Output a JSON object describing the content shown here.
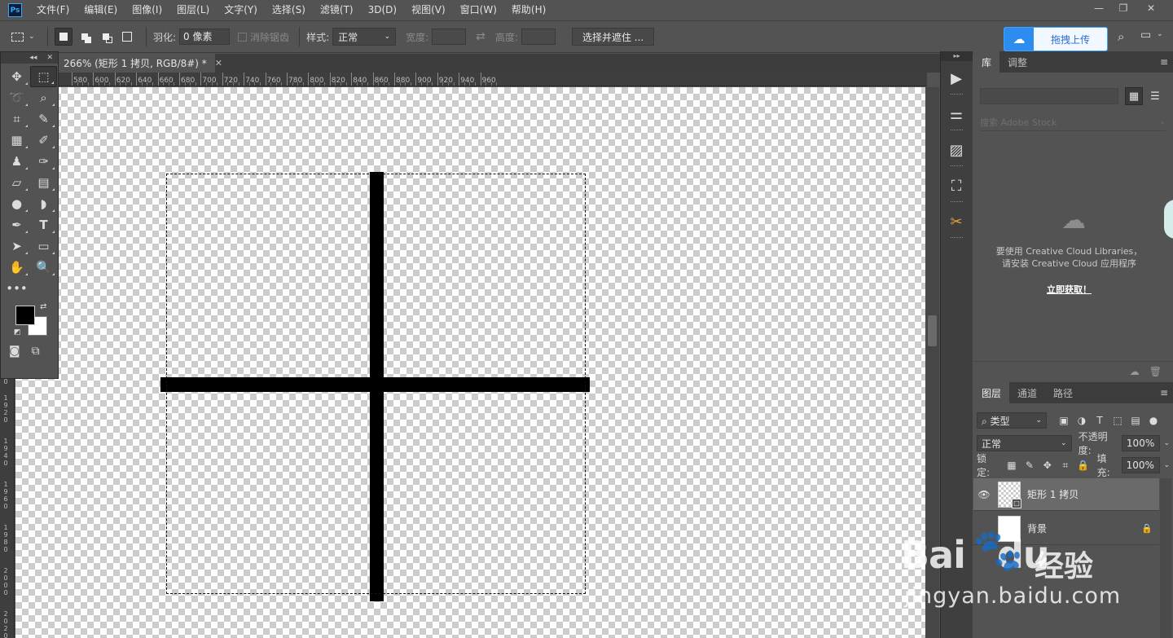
{
  "app": {
    "logo": "Ps"
  },
  "menu": [
    "文件(F)",
    "编辑(E)",
    "图像(I)",
    "图层(L)",
    "文字(Y)",
    "选择(S)",
    "滤镜(T)",
    "3D(D)",
    "视图(V)",
    "窗口(W)",
    "帮助(H)"
  ],
  "window_controls": {
    "minimize": "—",
    "restore": "❐",
    "close": "✕"
  },
  "options": {
    "feather_label": "羽化:",
    "feather_value": "0 像素",
    "antialias_label": "消除锯齿",
    "style_label": "样式:",
    "style_value": "正常",
    "width_label": "宽度:",
    "height_label": "高度:",
    "select_mask_button": "选择并遮住 ...",
    "upload_button": "拖拽上传"
  },
  "document": {
    "tab_title": "266% (矩形 1 拷贝, RGB/8#) *",
    "tab_close": "✕"
  },
  "ruler": {
    "top_ticks": [
      "580",
      "600",
      "620",
      "640",
      "660",
      "680",
      "700",
      "720",
      "740",
      "760",
      "780",
      "800",
      "820",
      "840",
      "860",
      "880",
      "900",
      "920",
      "940",
      "960"
    ],
    "left_ticks": [
      "0",
      "1920",
      "1940",
      "1960",
      "1980",
      "2000",
      "2020"
    ]
  },
  "toolbox": {
    "collapse": "◂◂",
    "close": "✕",
    "tools": [
      {
        "name": "move-tool",
        "glyph": "✥"
      },
      {
        "name": "rect-marquee-tool",
        "glyph": "⬚"
      },
      {
        "name": "lasso-tool",
        "glyph": "➰"
      },
      {
        "name": "quick-select-tool",
        "glyph": "⌕"
      },
      {
        "name": "crop-tool",
        "glyph": "⌗"
      },
      {
        "name": "eyedropper-tool",
        "glyph": "✎"
      },
      {
        "name": "frame-tool",
        "glyph": "▦"
      },
      {
        "name": "brush-tool",
        "glyph": "✐"
      },
      {
        "name": "stamp-tool",
        "glyph": "♟"
      },
      {
        "name": "history-brush-tool",
        "glyph": "✑"
      },
      {
        "name": "eraser-tool",
        "glyph": "▱"
      },
      {
        "name": "gradient-tool",
        "glyph": "▤"
      },
      {
        "name": "blur-tool",
        "glyph": "●"
      },
      {
        "name": "dodge-tool",
        "glyph": "◗"
      },
      {
        "name": "pen-tool",
        "glyph": "✒"
      },
      {
        "name": "type-tool",
        "glyph": "T"
      },
      {
        "name": "path-select-tool",
        "glyph": "➤"
      },
      {
        "name": "rectangle-tool",
        "glyph": "▭"
      },
      {
        "name": "hand-tool",
        "glyph": "✋"
      },
      {
        "name": "zoom-tool",
        "glyph": "🔍"
      },
      {
        "name": "more-tools",
        "glyph": "•••"
      },
      {
        "name": "empty-slot",
        "glyph": ""
      }
    ],
    "swap_glyph": "⇄",
    "defaults_glyph": "◩",
    "quickmask_glyph": "◙",
    "screenmode_glyph": "⧉"
  },
  "dock": {
    "collapse": "▸▸",
    "buttons": [
      {
        "name": "play-icon",
        "glyph": "▶"
      },
      {
        "name": "adjust-sliders-icon",
        "glyph": "⚌"
      },
      {
        "name": "image-library-icon",
        "glyph": "▨"
      },
      {
        "name": "face-scan-icon",
        "glyph": "⛶"
      },
      {
        "name": "tools-cross-icon",
        "glyph": "✂"
      }
    ]
  },
  "library_panel": {
    "tabs": [
      "库",
      "调整"
    ],
    "menu_glyph": "≡",
    "search_placeholder": "搜索 Adobe Stock",
    "message_line1": "要使用 Creative Cloud Libraries，",
    "message_line2": "请安装 Creative Cloud 应用程序",
    "cta": "立即获取！"
  },
  "layers_panel": {
    "tabs": [
      "图层",
      "通道",
      "路径"
    ],
    "filter_label": "类型",
    "blend_mode": "正常",
    "opacity_label": "不透明度:",
    "opacity_value": "100%",
    "lock_label": "锁定:",
    "fill_label": "填充:",
    "fill_value": "100%",
    "layers": [
      {
        "name": "矩形 1 拷贝",
        "selected": true,
        "visible": true
      },
      {
        "name": "背景",
        "selected": false,
        "visible": false,
        "locked": true
      }
    ]
  },
  "watermark": {
    "brand_left": "Bai",
    "brand_right": "du",
    "brand_cn": "经验",
    "url": "jingyan.baidu.com"
  },
  "colors": {
    "foreground": "#000000",
    "background": "#ffffff",
    "accent": "#31a8ff",
    "upload_brand": "#2d8cf0"
  }
}
